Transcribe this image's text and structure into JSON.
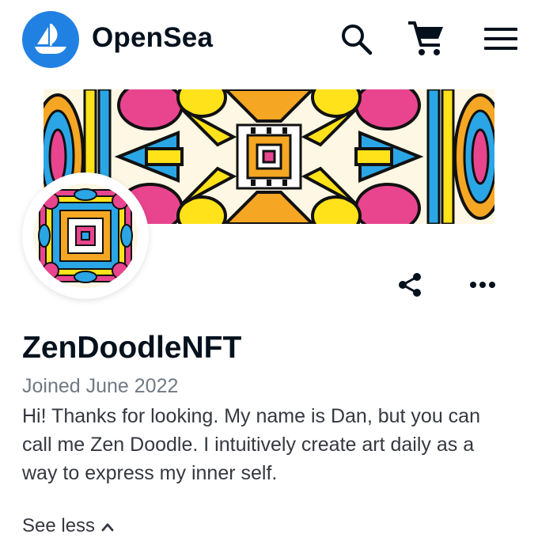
{
  "header": {
    "brand": "OpenSea",
    "icons": [
      "opensea-logo-icon",
      "search-icon",
      "cart-icon",
      "menu-icon"
    ]
  },
  "profile": {
    "username": "ZenDoodleNFT",
    "joined": "Joined June 2022",
    "bio": "Hi! Thanks for looking. My name is Dan, but you can call me Zen Doodle. I intuitively create art daily as a way to express my inner self.",
    "see_less": "See less",
    "actions": [
      "share-icon",
      "more-options-icon"
    ]
  },
  "colors": {
    "brand_blue": "#2081e2",
    "text_primary": "#04111d",
    "text_secondary": "#707a83",
    "art_yellow": "#ffe21a",
    "art_pink": "#e9458f",
    "art_blue": "#2aa6e6",
    "art_orange": "#f5a623"
  }
}
